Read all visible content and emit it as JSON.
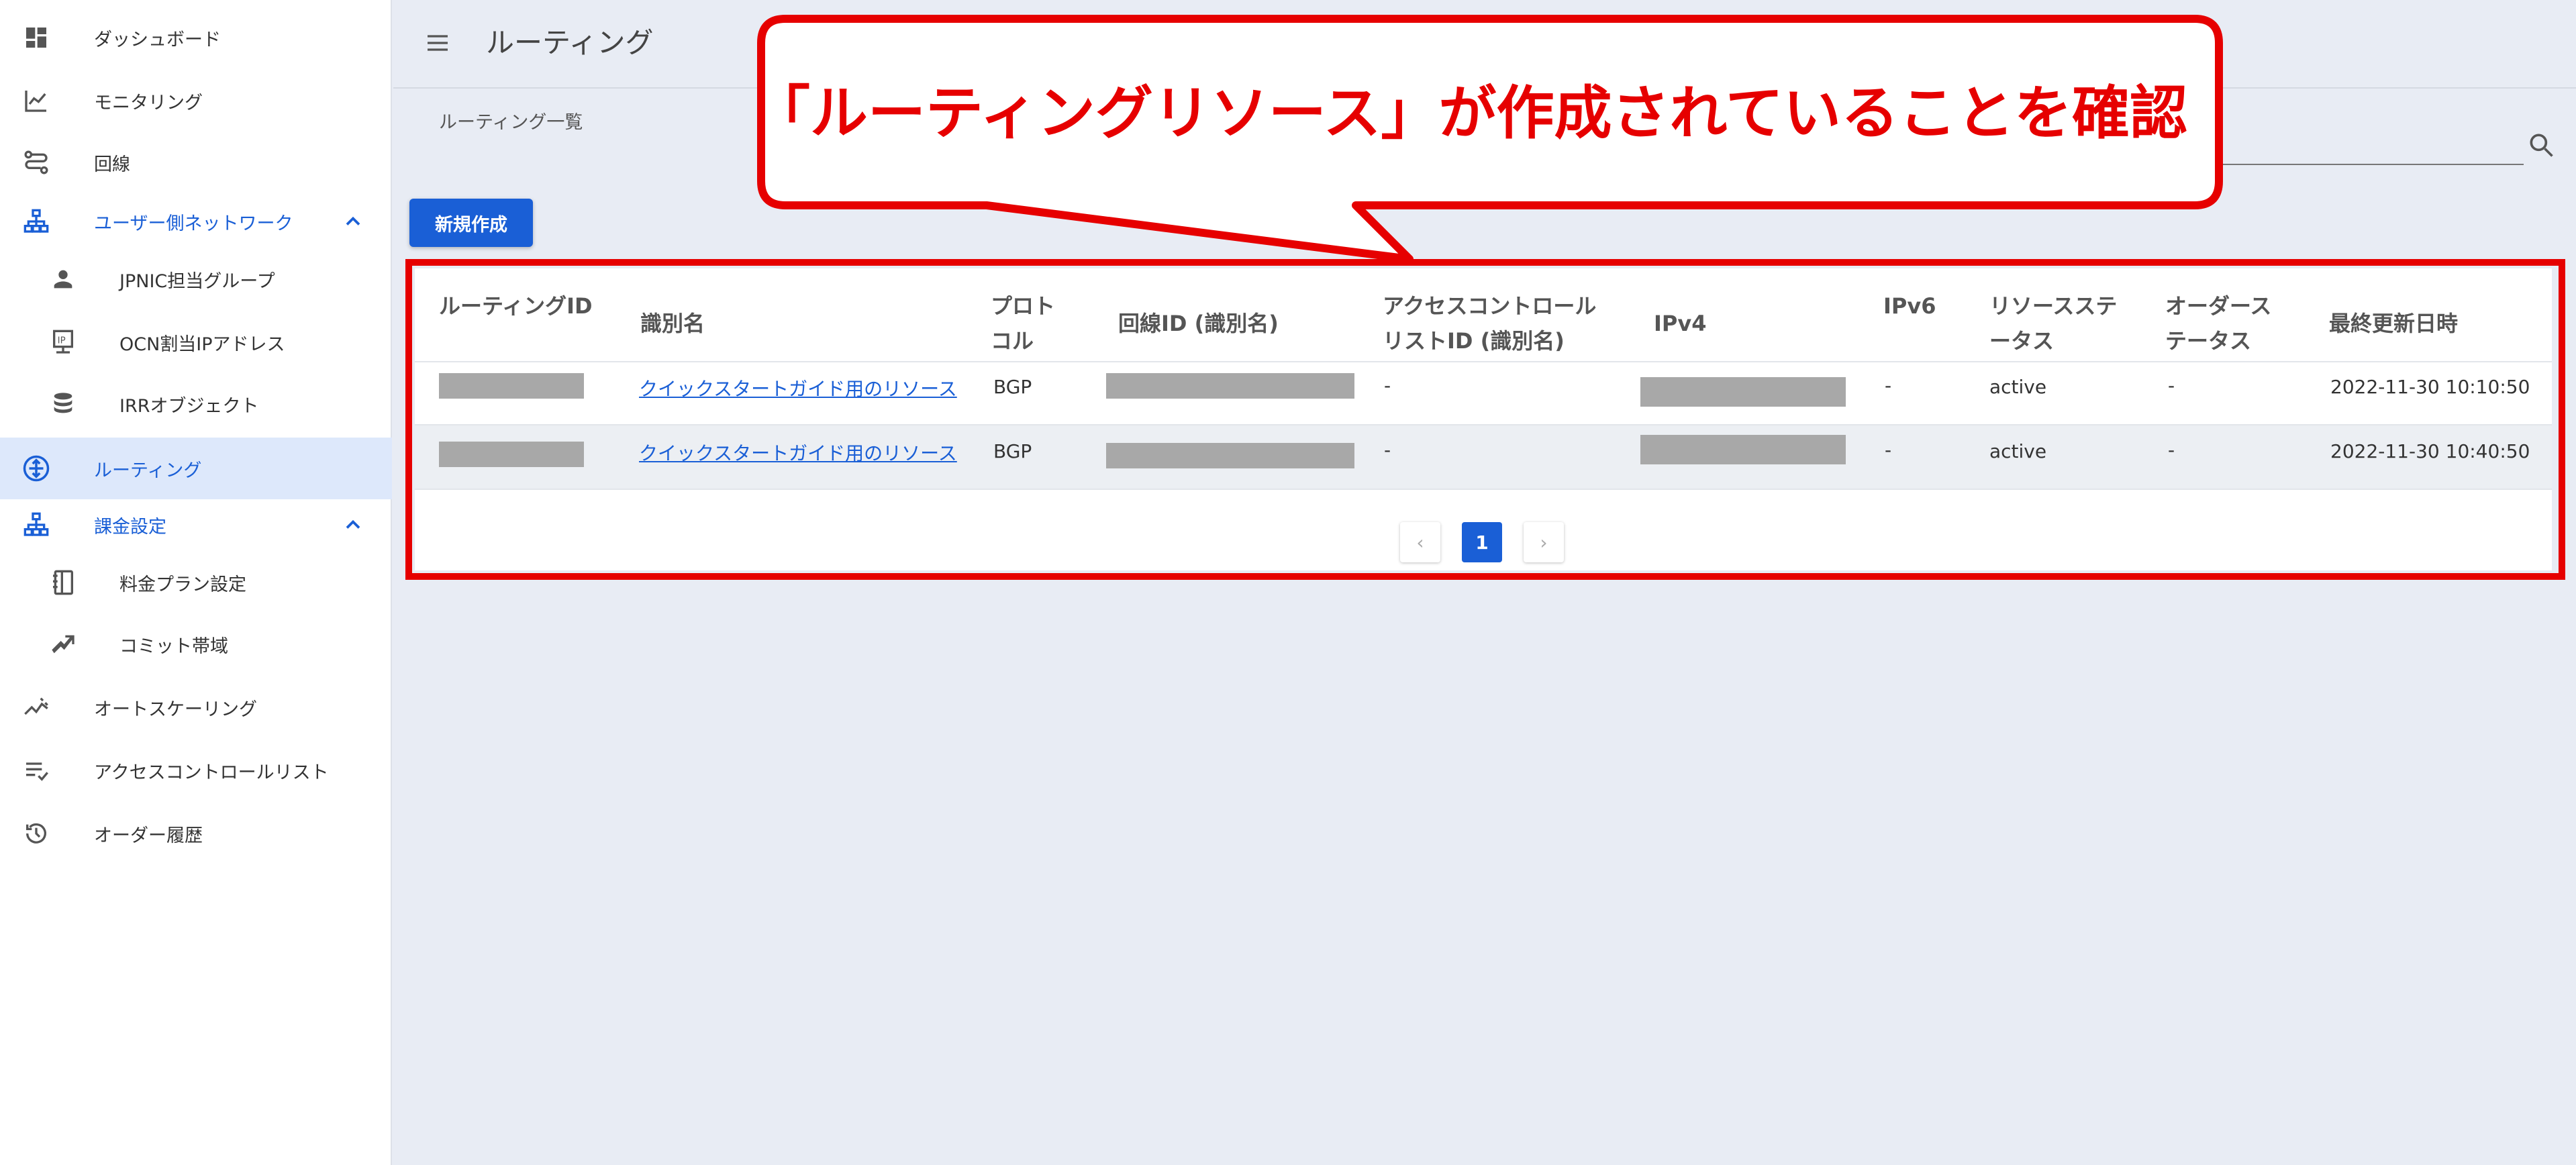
{
  "sidebar": {
    "items": [
      {
        "label": "ダッシュボード",
        "icon": "dashboard-icon"
      },
      {
        "label": "モニタリング",
        "icon": "chart-line-icon"
      },
      {
        "label": "回線",
        "icon": "route-icon"
      },
      {
        "label": "ユーザー側ネットワーク",
        "icon": "network-icon"
      },
      {
        "label": "JPNIC担当グループ",
        "icon": "person-icon"
      },
      {
        "label": "OCN割当IPアドレス",
        "icon": "ip-address-icon"
      },
      {
        "label": "IRRオブジェクト",
        "icon": "database-icon"
      },
      {
        "label": "ルーティング",
        "icon": "routing-icon"
      },
      {
        "label": "課金設定",
        "icon": "network-icon"
      },
      {
        "label": "料金プラン設定",
        "icon": "plan-icon"
      },
      {
        "label": "コミット帯域",
        "icon": "bandwidth-icon"
      },
      {
        "label": "オートスケーリング",
        "icon": "autoscaling-icon"
      },
      {
        "label": "アクセスコントロールリスト",
        "icon": "checklist-icon"
      },
      {
        "label": "オーダー履歴",
        "icon": "history-icon"
      }
    ]
  },
  "header": {
    "title": "ルーティング"
  },
  "breadcrumb": "ルーティング一覧",
  "new_button": "新規作成",
  "table": {
    "headers": {
      "routing_id": "ルーティングID",
      "name": "識別名",
      "protocol_1": "プロト",
      "protocol_2": "コル",
      "line_id": "回線ID (識別名)",
      "acl_1": "アクセスコントロール",
      "acl_2": "リストID (識別名)",
      "ipv4": "IPv4",
      "ipv6": "IPv6",
      "res_status_1": "リソースステ",
      "res_status_2": "ータス",
      "order_status_1": "オーダース",
      "order_status_2": "テータス",
      "updated": "最終更新日時"
    },
    "rows": [
      {
        "name": "クイックスタートガイド用のリソース",
        "protocol": "BGP",
        "acl": "-",
        "ipv6": "-",
        "resource_status": "active",
        "order_status": "-",
        "updated": "2022-11-30 10:10:50"
      },
      {
        "name": "クイックスタートガイド用のリソース",
        "protocol": "BGP",
        "acl": "-",
        "ipv6": "-",
        "resource_status": "active",
        "order_status": "-",
        "updated": "2022-11-30 10:40:50"
      }
    ]
  },
  "pagination": {
    "current": "1",
    "prev": "‹",
    "next": "›"
  },
  "annotation": {
    "text": "「ルーティングリソース」が作成されていることを確認",
    "color": "#e60000"
  },
  "colors": {
    "accent": "#1a5fd6",
    "annotation": "#e60000"
  }
}
